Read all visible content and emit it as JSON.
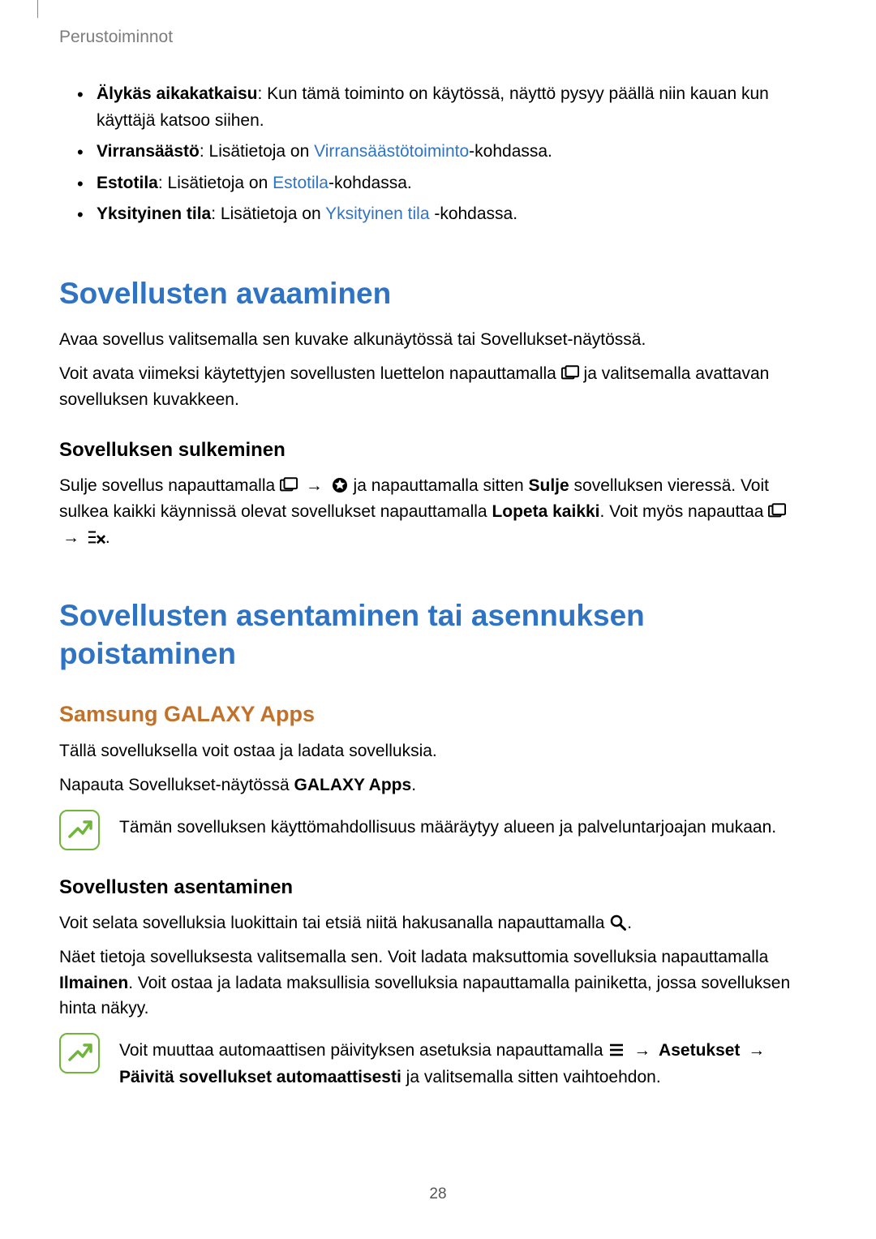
{
  "header": {
    "breadcrumb": "Perustoiminnot"
  },
  "bullets": [
    {
      "bold": "Älykäs aikakatkaisu",
      "rest": ": Kun tämä toiminto on käytössä, näyttö pysyy päällä niin kauan kun käyttäjä katsoo siihen."
    },
    {
      "bold": "Virransäästö",
      "pre": ": Lisätietoja on ",
      "link": "Virransäästötoiminto",
      "post": "-kohdassa."
    },
    {
      "bold": "Estotila",
      "pre": ": Lisätietoja on ",
      "link": "Estotila",
      "post": "-kohdassa."
    },
    {
      "bold": "Yksityinen tila",
      "pre": ": Lisätietoja on ",
      "link": "Yksityinen tila",
      "post": " -kohdassa."
    }
  ],
  "sec1": {
    "title": "Sovellusten avaaminen",
    "p1": "Avaa sovellus valitsemalla sen kuvake alkunäytössä tai Sovellukset-näytössä.",
    "p2a": "Voit avata viimeksi käytettyjen sovellusten luettelon napauttamalla ",
    "p2b": " ja valitsemalla avattavan sovelluksen kuvakkeen.",
    "sub": "Sovelluksen sulkeminen",
    "p3a": "Sulje sovellus napauttamalla ",
    "p3b": " ja napauttamalla sitten ",
    "p3bold": "Sulje",
    "p3c": " sovelluksen vieressä. Voit sulkea kaikki käynnissä olevat sovellukset napauttamalla ",
    "p3bold2": "Lopeta kaikki",
    "p3d": ". Voit myös napauttaa ",
    "p3e": "."
  },
  "sec2": {
    "title": "Sovellusten asentaminen tai asennuksen poistaminen",
    "sub1": "Samsung GALAXY Apps",
    "p1": "Tällä sovelluksella voit ostaa ja ladata sovelluksia.",
    "p2a": "Napauta Sovellukset-näytössä ",
    "p2bold": "GALAXY Apps",
    "p2b": ".",
    "note1": "Tämän sovelluksen käyttömahdollisuus määräytyy alueen ja palveluntarjoajan mukaan.",
    "sub2": "Sovellusten asentaminen",
    "p3a": "Voit selata sovelluksia luokittain tai etsiä niitä hakusanalla napauttamalla ",
    "p3b": ".",
    "p4a": "Näet tietoja sovelluksesta valitsemalla sen. Voit ladata maksuttomia sovelluksia napauttamalla ",
    "p4bold": "Ilmainen",
    "p4b": ". Voit ostaa ja ladata maksullisia sovelluksia napauttamalla painiketta, jossa sovelluksen hinta näkyy.",
    "note2a": "Voit muuttaa automaattisen päivityksen asetuksia napauttamalla ",
    "note2bold1": "Asetukset",
    "note2bold2": "Päivitä sovellukset automaattisesti",
    "note2b": " ja valitsemalla sitten vaihtoehdon."
  },
  "arrow": "→",
  "page_number": "28"
}
